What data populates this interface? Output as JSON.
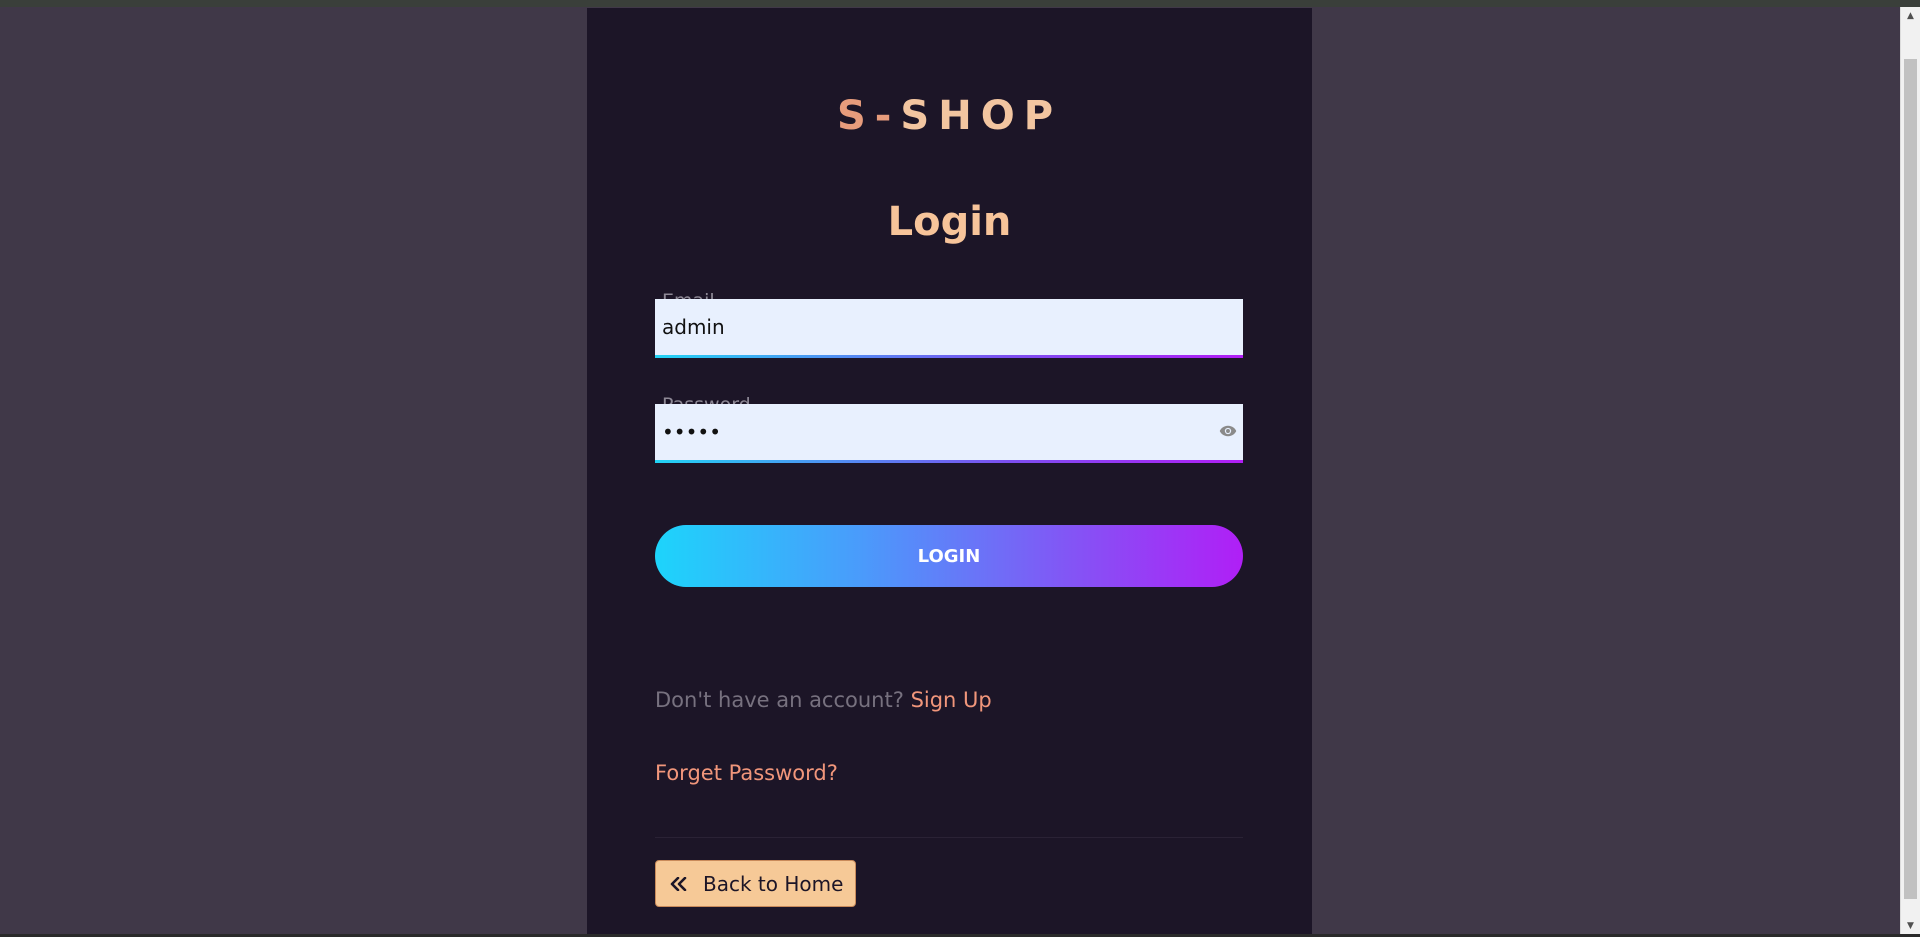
{
  "brand": {
    "logo_prefix": "S-",
    "logo_suffix": "SHOP"
  },
  "form": {
    "title": "Login",
    "email_label": "Email",
    "email_value": "admin",
    "password_label": "Password",
    "password_value": "admin",
    "login_button": "LOGIN"
  },
  "links": {
    "no_account_text": "Don't have an account?",
    "signup_label": "Sign Up",
    "forgot_label": "Forget Password?"
  },
  "back": {
    "label": "Back to Home"
  },
  "icons": {
    "password_toggle": "eye-icon",
    "back": "double-chevron-left-icon",
    "scroll_up": "chevron-up-icon",
    "scroll_down": "chevron-down-icon"
  },
  "colors": {
    "page_bg": "#403848",
    "card_bg": "#1c1527",
    "accent_peach": "#f7c49a",
    "link_coral": "#f1967b",
    "gradient_start": "#1dd4fb",
    "gradient_end": "#b01ff6"
  }
}
